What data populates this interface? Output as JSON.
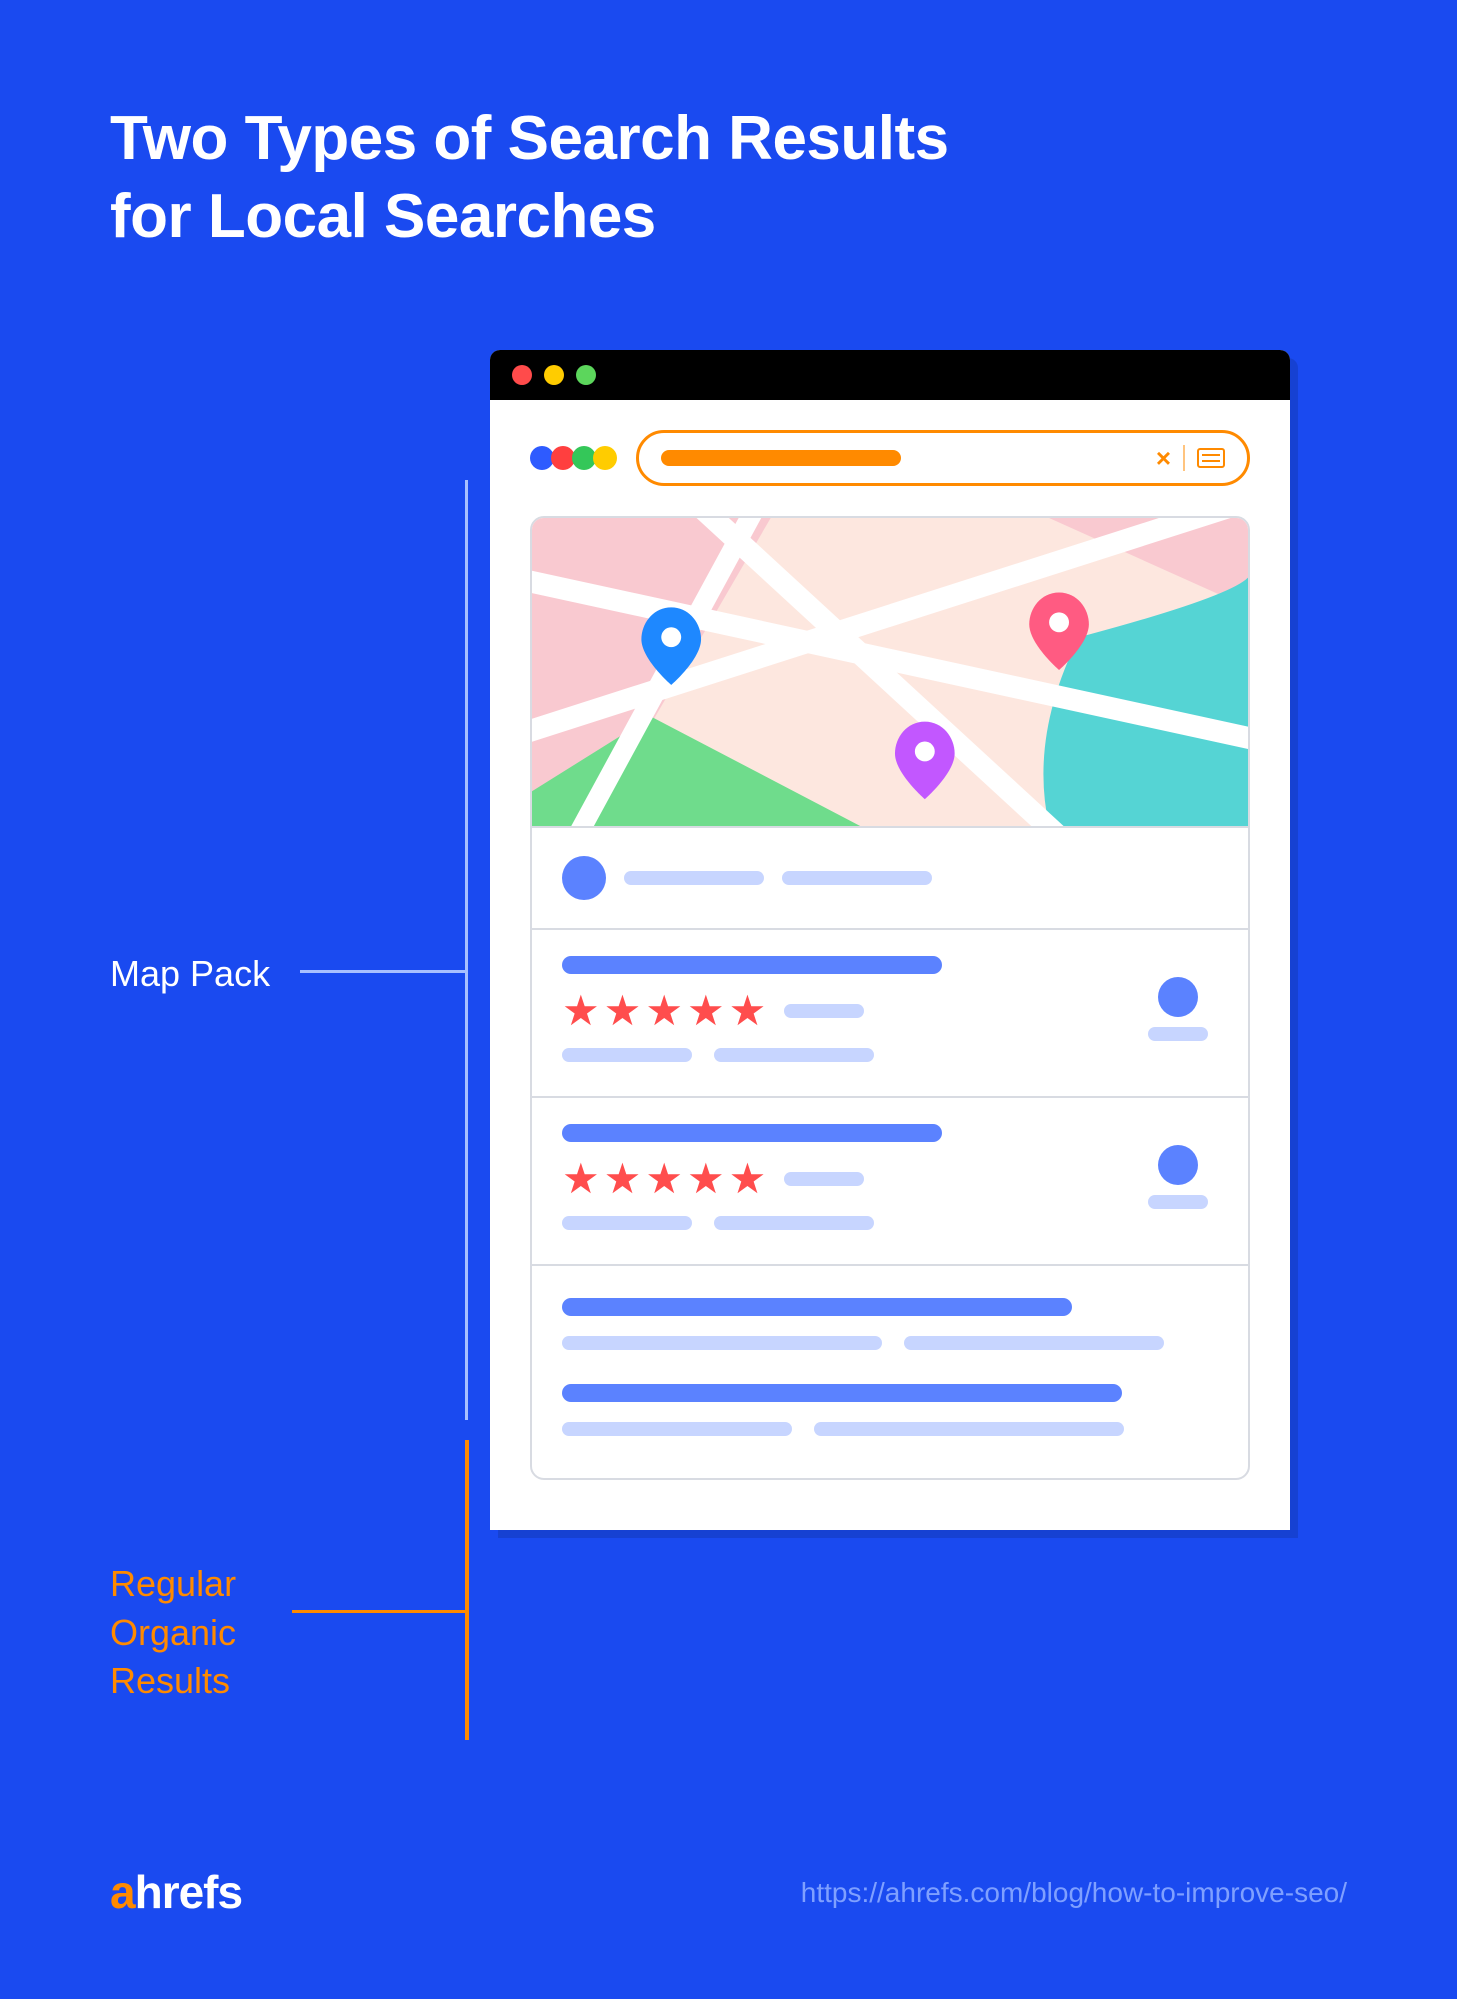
{
  "title_line1": "Two Types of Search Results",
  "title_line2": "for Local Searches",
  "labels": {
    "map_pack": "Map Pack",
    "organic": "Regular\nOrganic\nResults"
  },
  "footer": {
    "brand_prefix": "a",
    "brand_rest": "hrefs",
    "url": "https://ahrefs.com/blog/how-to-improve-seo/"
  },
  "search": {
    "close_glyph": "×"
  },
  "listings": [
    {
      "stars": 5
    },
    {
      "stars": 5
    }
  ],
  "colors": {
    "bg": "#1a4af0",
    "accent": "#ff8a00",
    "blue": "#5b82ff",
    "lightblue": "#c7d5ff",
    "star": "#ff4d4d"
  }
}
